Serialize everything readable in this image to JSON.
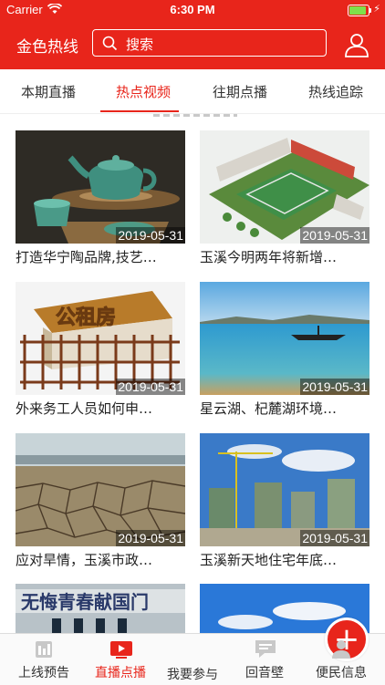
{
  "status_bar": {
    "carrier": "Carrier",
    "time": "6:30 PM",
    "battery_level": 0.9
  },
  "header": {
    "title": "金色热线",
    "search_placeholder": "搜索"
  },
  "tabs": [
    {
      "label": "本期直播",
      "active": false
    },
    {
      "label": "热点视频",
      "active": true
    },
    {
      "label": "往期点播",
      "active": false
    },
    {
      "label": "热线追踪",
      "active": false
    }
  ],
  "videos": [
    {
      "caption": "打造华宁陶品牌,技艺…",
      "date": "2019-05-31",
      "thumb": "teapot"
    },
    {
      "caption": "玉溪今明两年将新增…",
      "date": "2019-05-31",
      "thumb": "school-aerial"
    },
    {
      "caption": "外来务工人员如何申…",
      "date": "2019-05-31",
      "thumb": "public-housing"
    },
    {
      "caption": "星云湖、杞麓湖环境…",
      "date": "2019-05-31",
      "thumb": "lake-boat"
    },
    {
      "caption": "应对旱情，玉溪市政…",
      "date": "2019-05-31",
      "thumb": "dry-land"
    },
    {
      "caption": "玉溪新天地住宅年底…",
      "date": "2019-05-31",
      "thumb": "construction"
    },
    {
      "caption": "",
      "date": "",
      "thumb": "youth-banner",
      "banner_text": "无悔青春献国门"
    },
    {
      "caption": "",
      "date": "",
      "thumb": "blue-sky"
    }
  ],
  "bottom_nav": [
    {
      "label": "上线预告",
      "icon": "schedule-icon",
      "active": false
    },
    {
      "label": "直播点播",
      "icon": "play-icon",
      "active": true
    },
    {
      "label": "我要参与",
      "icon": "plus-icon",
      "active": false
    },
    {
      "label": "回音壁",
      "icon": "message-icon",
      "active": false
    },
    {
      "label": "便民信息",
      "icon": "person-icon",
      "active": false
    }
  ],
  "colors": {
    "brand_red": "#e8251b"
  }
}
